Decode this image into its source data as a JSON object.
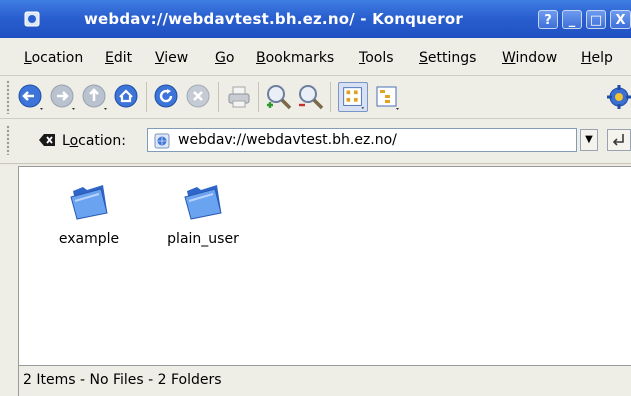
{
  "window": {
    "title": "webdav://webdavtest.bh.ez.no/ - Konqueror",
    "controls": {
      "help": "?",
      "minimize": "_",
      "maximize": "□",
      "close": "X"
    }
  },
  "menubar": {
    "items": [
      {
        "label": "Location",
        "mnemonic": "L"
      },
      {
        "label": "Edit",
        "mnemonic": "E"
      },
      {
        "label": "View",
        "mnemonic": "V"
      },
      {
        "label": "Go",
        "mnemonic": "G"
      },
      {
        "label": "Bookmarks",
        "mnemonic": "B"
      },
      {
        "label": "Tools",
        "mnemonic": "T"
      },
      {
        "label": "Settings",
        "mnemonic": "S"
      },
      {
        "label": "Window",
        "mnemonic": "W"
      },
      {
        "label": "Help",
        "mnemonic": "H"
      }
    ]
  },
  "toolbar": {
    "icons": [
      "back-icon",
      "forward-icon",
      "up-icon",
      "home-icon",
      "reload-icon",
      "stop-icon",
      "print-icon",
      "zoom-in-icon",
      "zoom-out-icon",
      "icon-view-icon",
      "tree-view-icon",
      "konqueror-gear-icon"
    ],
    "active_view": "icon-view"
  },
  "location": {
    "label": "Location:",
    "value": "webdav://webdavtest.bh.ez.no/"
  },
  "files": [
    {
      "name": "example",
      "type": "folder"
    },
    {
      "name": "plain_user",
      "type": "folder"
    }
  ],
  "status": {
    "text": "2 Items - No Files - 2 Folders"
  },
  "colors": {
    "titlebar": "#2a5fcf",
    "chrome": "#eeede6",
    "folder": "#4a86e8"
  }
}
